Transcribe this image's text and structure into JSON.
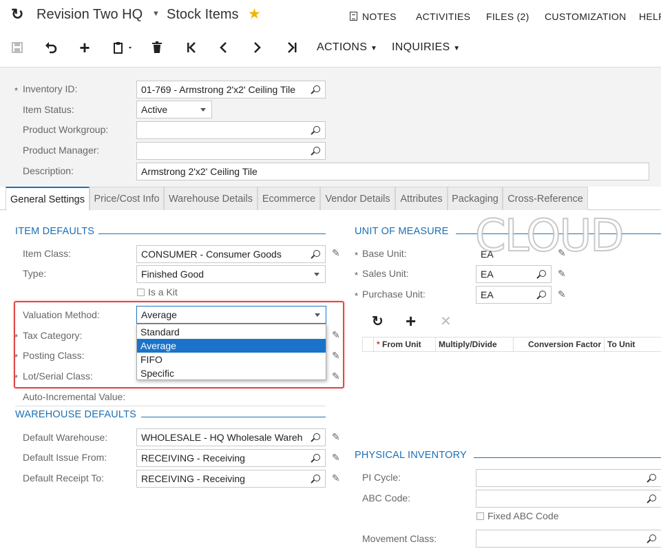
{
  "header": {
    "company": "Revision Two HQ",
    "screen_title": "Stock Items",
    "links": {
      "notes": "NOTES",
      "activities": "ACTIVITIES",
      "files": "FILES (2)",
      "customization": "CUSTOMIZATION",
      "help": "HELP"
    }
  },
  "toolbar": {
    "actions": "ACTIONS",
    "inquiries": "INQUIRIES"
  },
  "form": {
    "inventory_id_label": "Inventory ID:",
    "inventory_id_value": "01-769 - Armstrong 2'x2' Ceiling Tile",
    "item_status_label": "Item Status:",
    "item_status_value": "Active",
    "product_workgroup_label": "Product Workgroup:",
    "product_manager_label": "Product Manager:",
    "description_label": "Description:",
    "description_value": "Armstrong 2'x2' Ceiling Tile"
  },
  "tabs": [
    "General Settings",
    "Price/Cost Info",
    "Warehouse Details",
    "Ecommerce",
    "Vendor Details",
    "Attributes",
    "Packaging",
    "Cross-Reference"
  ],
  "item_defaults": {
    "title": "ITEM DEFAULTS",
    "item_class_label": "Item Class:",
    "item_class_value": "CONSUMER - Consumer Goods",
    "type_label": "Type:",
    "type_value": "Finished Good",
    "is_kit_label": "Is a Kit",
    "valuation_label": "Valuation Method:",
    "valuation_value": "Average",
    "valuation_options": [
      "Standard",
      "Average",
      "FIFO",
      "Specific"
    ],
    "tax_category_label": "Tax Category:",
    "posting_class_label": "Posting Class:",
    "lot_serial_label": "Lot/Serial Class:",
    "auto_incremental_label": "Auto-Incremental Value:"
  },
  "warehouse_defaults": {
    "title": "WAREHOUSE DEFAULTS",
    "default_warehouse_label": "Default Warehouse:",
    "default_warehouse_value": "WHOLESALE - HQ Wholesale Wareh",
    "default_issue_label": "Default Issue From:",
    "default_issue_value": "RECEIVING - Receiving",
    "default_receipt_label": "Default Receipt To:",
    "default_receipt_value": "RECEIVING - Receiving"
  },
  "unit_of_measure": {
    "title": "UNIT OF MEASURE",
    "base_unit_label": "Base Unit:",
    "base_unit_value": "EA",
    "sales_unit_label": "Sales Unit:",
    "sales_unit_value": "EA",
    "purchase_unit_label": "Purchase Unit:",
    "purchase_unit_value": "EA",
    "grid_columns": [
      "From Unit",
      "Multiply/Divide",
      "Conversion Factor",
      "To Unit"
    ]
  },
  "physical_inventory": {
    "title": "PHYSICAL INVENTORY",
    "pi_cycle_label": "PI Cycle:",
    "abc_code_label": "ABC Code:",
    "fixed_abc_label": "Fixed ABC Code",
    "movement_class_label": "Movement Class:"
  },
  "watermark": "CLOUD",
  "colors": {
    "accent": "#1a6fb6",
    "highlight_box": "#e04848",
    "selected_option": "#1a73c9",
    "star": "#f0b400"
  }
}
